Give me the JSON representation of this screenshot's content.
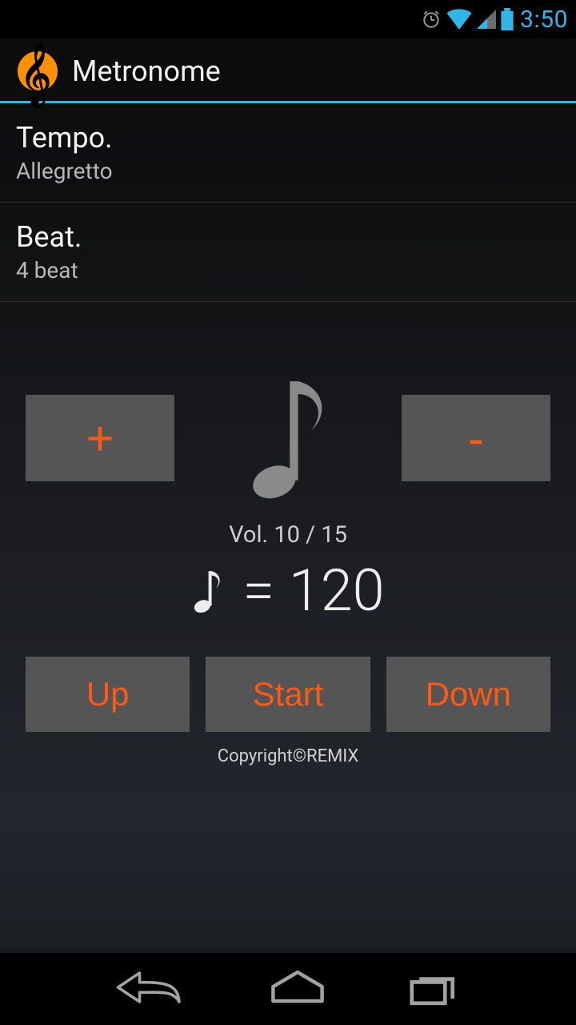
{
  "status": {
    "time": "3:50"
  },
  "app": {
    "title": "Metronome"
  },
  "tempo": {
    "label": "Tempo.",
    "value": "Allegretto"
  },
  "beat": {
    "label": "Beat.",
    "value": "4 beat"
  },
  "controls": {
    "plus_label": "+",
    "minus_label": "-",
    "volume_text": "Vol. 10 / 15",
    "bpm_text": " =  120",
    "up_label": "Up",
    "start_label": "Start",
    "down_label": "Down"
  },
  "footer": {
    "copyright": "Copyright©REMIX"
  }
}
